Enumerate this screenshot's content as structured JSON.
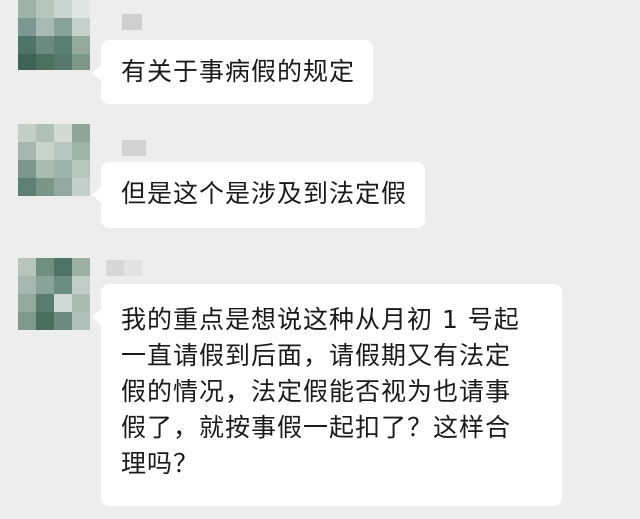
{
  "chat": {
    "messages": [
      {
        "sender_name": "",
        "text": "有关于事病假的规定"
      },
      {
        "sender_name": "",
        "text": "但是这个是涉及到法定假"
      },
      {
        "sender_name": "",
        "text": "我的重点是想说这种从月初 1 号起\n一直请假到后面，请假期又有法定\n假的情况，法定假能否视为也请事\n假了，就按事假一起扣了？这样合\n理吗？"
      }
    ]
  },
  "colors": {
    "background": "#ededed",
    "bubble": "#ffffff",
    "text": "#1a1a1a",
    "avatar_blur": [
      "#3d6b5a",
      "#6f8f83",
      "#a9bcb4",
      "#d7dfdb",
      "#52776a",
      "#8ea69c"
    ]
  },
  "icons": {
    "avatar": "blurred-avatar-icon",
    "name": "blurred-name-icon"
  }
}
